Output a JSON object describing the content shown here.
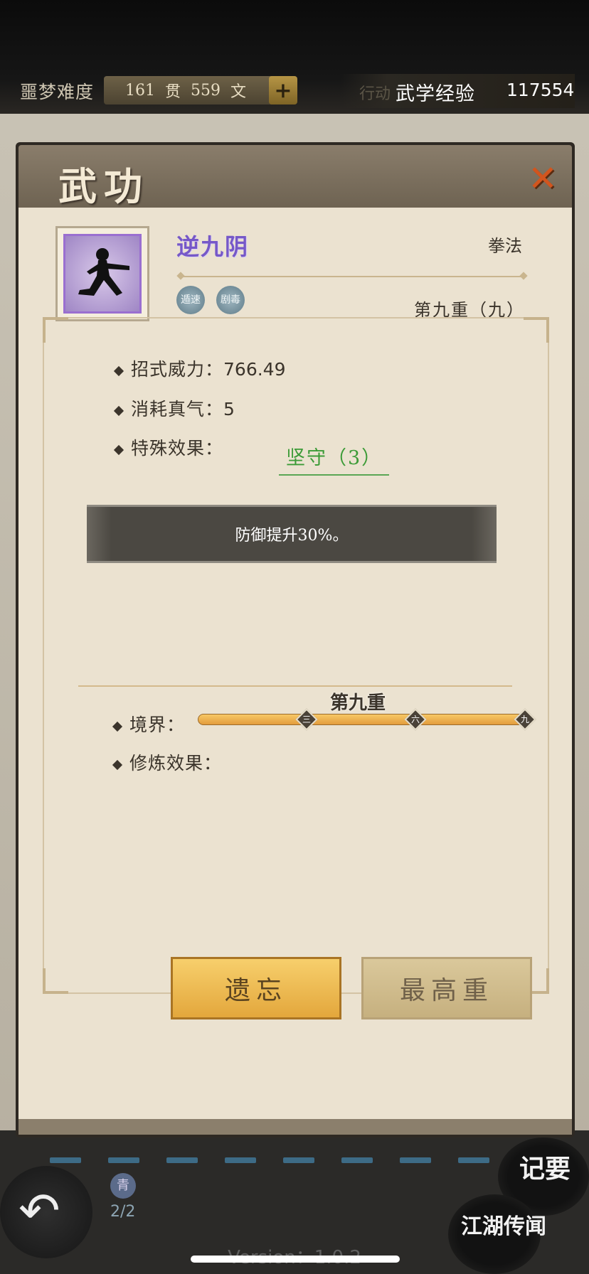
{
  "topbar": {
    "difficulty_label": "噩梦难度",
    "money_guan": "161",
    "money_guan_unit": "贯",
    "money_wen": "559",
    "money_wen_unit": "文",
    "money_add": "+",
    "hidden_label": "行动",
    "exp_label": "武学经验",
    "exp_value": "117554"
  },
  "dialog": {
    "title": "武功",
    "close": "✕",
    "skill": {
      "name": "逆九阴",
      "type": "拳法",
      "tags": [
        "遁速",
        "剧毒"
      ],
      "level_text": "第九重（九）"
    },
    "stats": {
      "power_label": "招式威力：",
      "power_value": "766.49",
      "qi_label": "消耗真气：",
      "qi_value": "5",
      "special_label": "特殊效果：",
      "special_value": "坚守（3）",
      "description": "防御提升30%。"
    },
    "realm": {
      "label": "境界：",
      "current": "第九重",
      "markers": [
        "三",
        "六",
        "九"
      ],
      "progress": 1.0,
      "train_label": "修炼效果："
    },
    "buttons": {
      "forget": "遗忘",
      "max": "最高重"
    }
  },
  "bottom": {
    "pager_icon": "青",
    "pager": "2/2",
    "jiyao": "记要",
    "jianghu": "江湖传闻",
    "version": "Version：1.0.2"
  },
  "colors": {
    "skill_name": "#7658c8",
    "effect": "#3c9b37",
    "button_primary": "#f0bb55",
    "button_secondary": "#d3bf8e"
  }
}
